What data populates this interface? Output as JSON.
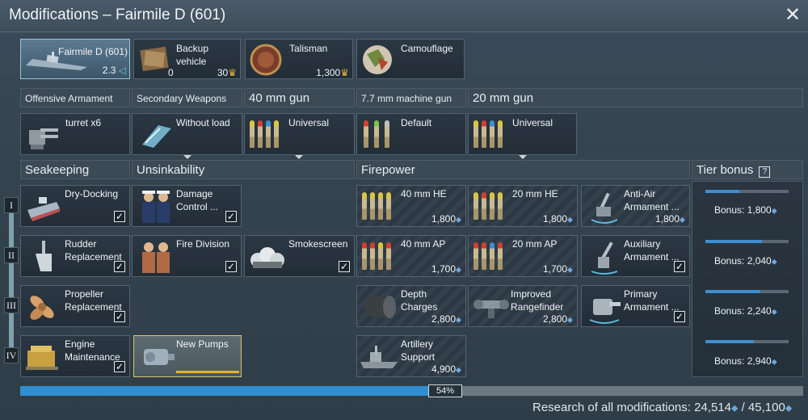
{
  "window": {
    "title": "Modifications – Fairmile D (601)"
  },
  "top_cards": {
    "vehicle": {
      "name": "Fairmile D (601)",
      "rank": "2.3",
      "rank_icon": "◁"
    },
    "backup": {
      "label": "Backup vehicle",
      "count": "0",
      "price": "30"
    },
    "talisman": {
      "label": "Talisman",
      "price": "1,300"
    },
    "camouflage": {
      "label": "Camouflage"
    }
  },
  "weapon_headers": {
    "offensive": "Offensive Armament",
    "secondary": "Secondary Weapons",
    "gun40": "40 mm gun",
    "mg77": "7.7 mm machine gun",
    "gun20": "20 mm gun"
  },
  "weapon_cards": {
    "offensive": "turret x6",
    "secondary": "Without load",
    "gun40": "Universal",
    "mg77": "Default",
    "gun20": "Universal"
  },
  "section_headers": {
    "seakeeping": "Seakeeping",
    "unsinkability": "Unsinkability",
    "firepower": "Firepower",
    "tier_bonus": "Tier bonus",
    "tier_bonus_help": "?"
  },
  "tiers": [
    "I",
    "II",
    "III",
    "IV"
  ],
  "modules": {
    "dry_docking": "Dry-Docking",
    "rudder": "Rudder Replacement",
    "propeller": "Propeller Replacement",
    "engine": "Engine Maintenance",
    "damage_control": "Damage Control ...",
    "fire_division": "Fire Division",
    "smokescreen": "Smokescreen",
    "new_pumps": "New Pumps",
    "he40": {
      "label": "40 mm HE",
      "cost": "1,800"
    },
    "he20": {
      "label": "20 mm HE",
      "cost": "1,800"
    },
    "anti_air": {
      "label": "Anti-Air Armament ...",
      "cost": "1,800"
    },
    "ap40": {
      "label": "40 mm AP",
      "cost": "1,700"
    },
    "ap20": {
      "label": "20 mm AP",
      "cost": "1,700"
    },
    "auxiliary": "Auxiliary Armament ...",
    "depth": {
      "label": "Depth Charges",
      "cost": "2,800"
    },
    "rangefinder": {
      "label": "Improved Rangefinder",
      "cost": "2,800"
    },
    "primary": "Primary Armament ...",
    "artillery": {
      "label": "Artillery Support",
      "cost": "4,900"
    }
  },
  "tier_bonus": [
    {
      "text": "Bonus: 1,800",
      "fill": 0.41
    },
    {
      "text": "Bonus: 2,040",
      "fill": 0.68
    },
    {
      "text": "Bonus: 2,240",
      "fill": 0.66
    },
    {
      "text": "Bonus: 2,940",
      "fill": 0.58
    }
  ],
  "progress": {
    "percent_label": "54%",
    "fill": 0.54,
    "research_label": "Research of all modifications:",
    "researched": "24,514",
    "total": "45,100"
  },
  "colors": {
    "accent": "#2f8fd0",
    "currency": "#6fa8dc"
  }
}
